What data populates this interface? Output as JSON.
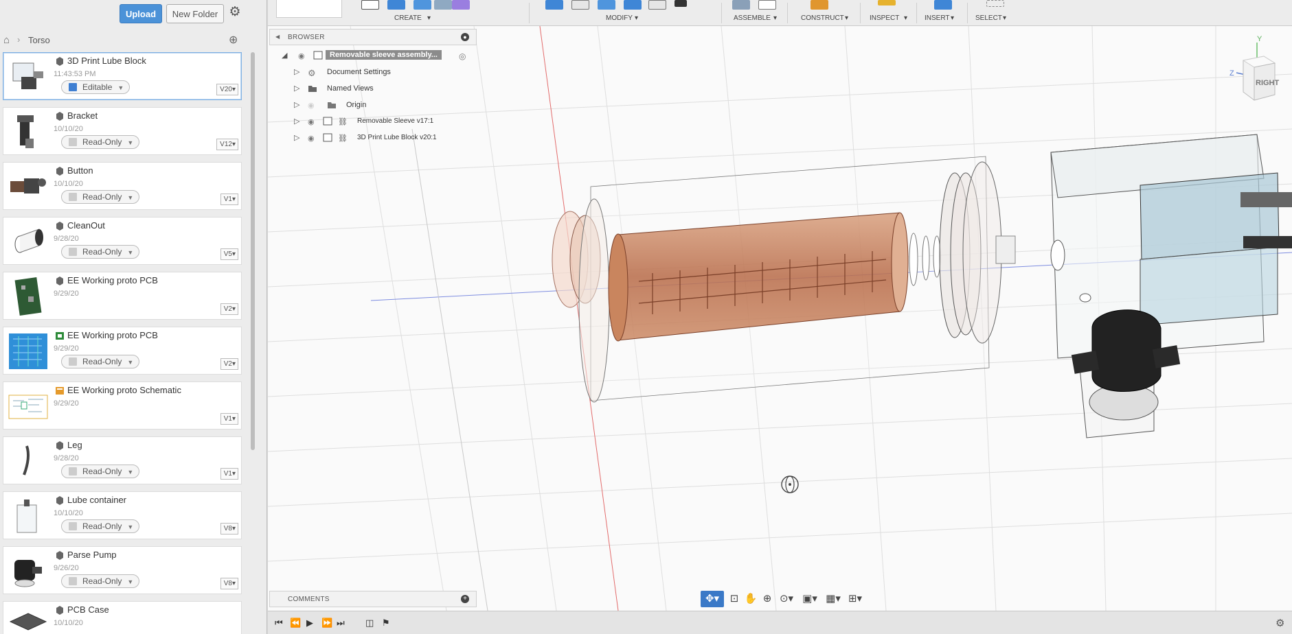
{
  "data_panel": {
    "upload_label": "Upload",
    "new_folder_label": "New Folder",
    "breadcrumb": "Torso",
    "files": [
      {
        "name": "3D Print Lube Block",
        "date": "11:43:53 PM",
        "status": "Editable",
        "version": "V20",
        "type": "design",
        "selected": true
      },
      {
        "name": "Bracket",
        "date": "10/10/20",
        "status": "Read-Only",
        "version": "V12",
        "type": "design"
      },
      {
        "name": "Button",
        "date": "10/10/20",
        "status": "Read-Only",
        "version": "V1",
        "type": "design"
      },
      {
        "name": "CleanOut",
        "date": "9/28/20",
        "status": "Read-Only",
        "version": "V5",
        "type": "design"
      },
      {
        "name": "EE Working proto PCB",
        "date": "9/29/20",
        "status": "",
        "version": "V2",
        "type": "design"
      },
      {
        "name": "EE Working proto PCB",
        "date": "9/29/20",
        "status": "Read-Only",
        "version": "V2",
        "type": "pcb"
      },
      {
        "name": "EE Working proto Schematic",
        "date": "9/29/20",
        "status": "",
        "version": "V1",
        "type": "schematic"
      },
      {
        "name": "Leg",
        "date": "9/28/20",
        "status": "Read-Only",
        "version": "V1",
        "type": "design"
      },
      {
        "name": "Lube container",
        "date": "10/10/20",
        "status": "Read-Only",
        "version": "V8",
        "type": "design"
      },
      {
        "name": "Parse Pump",
        "date": "9/26/20",
        "status": "Read-Only",
        "version": "V8",
        "type": "design"
      },
      {
        "name": "PCB Case",
        "date": "10/10/20",
        "status": "",
        "version": "",
        "type": "design"
      }
    ]
  },
  "toolbar": {
    "groups": [
      "CREATE",
      "MODIFY",
      "ASSEMBLE",
      "CONSTRUCT",
      "INSPECT",
      "INSERT",
      "SELECT"
    ]
  },
  "browser": {
    "title": "BROWSER",
    "root": "Removable sleeve assembly...",
    "items": [
      "Document Settings",
      "Named Views",
      "Origin",
      "Removable Sleeve v17:1",
      "3D Print Lube Block v20:1"
    ]
  },
  "comments": {
    "title": "COMMENTS"
  },
  "viewcube": {
    "face": "RIGHT",
    "axis_y": "Y",
    "axis_z": "Z"
  },
  "colors": {
    "accent": "#4b92d8",
    "sleeve": "#c9855e",
    "grid": "#dcdcdc"
  }
}
